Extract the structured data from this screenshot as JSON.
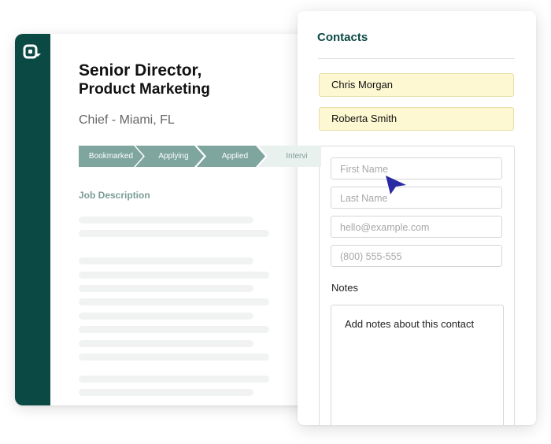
{
  "job": {
    "title_line1": "Senior Director,",
    "title_line2": "Product Marketing",
    "subtitle": "Chief - Miami, FL",
    "pipeline": [
      "Bookmarked",
      "Applying",
      "Applied",
      "Intervi"
    ],
    "section_heading": "Job Description"
  },
  "contacts": {
    "title": "Contacts",
    "people": [
      "Chris Morgan",
      "Roberta Smith"
    ],
    "form": {
      "first_name_placeholder": "First Name",
      "last_name_placeholder": "Last Name",
      "email_placeholder": "hello@example.com",
      "phone_placeholder": "(800) 555-555",
      "notes_label": "Notes",
      "notes_placeholder": "Add notes about this contact"
    }
  },
  "colors": {
    "sidebar": "#0b4a44",
    "pipeline_active": "#7ea59e",
    "chip_bg": "#fdf8d2",
    "cursor": "#2a2aa5"
  },
  "icons": {
    "logo": "app-logo-icon",
    "cursor": "mouse-cursor-icon"
  }
}
